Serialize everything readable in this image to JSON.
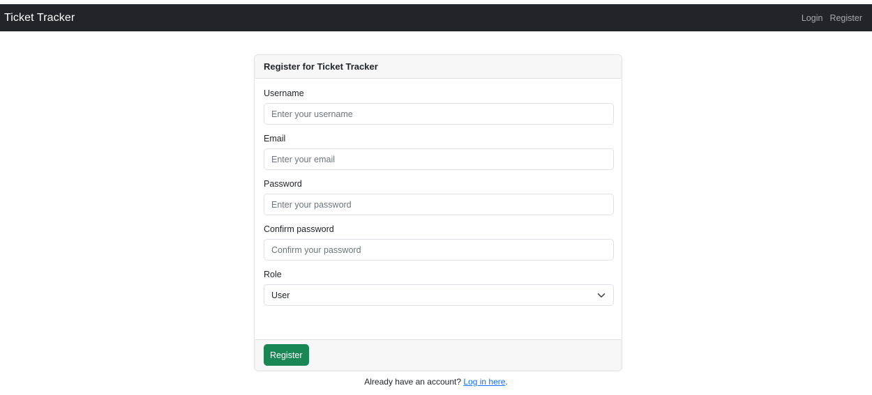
{
  "navbar": {
    "brand": "Ticket Tracker",
    "links": [
      "Login",
      "Register"
    ]
  },
  "card": {
    "title": "Register for Ticket Tracker",
    "fields": {
      "username": {
        "label": "Username",
        "placeholder": "Enter your username",
        "value": ""
      },
      "email": {
        "label": "Email",
        "placeholder": "Enter your email",
        "value": ""
      },
      "password": {
        "label": "Password",
        "placeholder": "Enter your password",
        "value": ""
      },
      "confirm": {
        "label": "Confirm password",
        "placeholder": "Confirm your password",
        "value": ""
      },
      "role": {
        "label": "Role",
        "value": "User"
      }
    },
    "submit_label": "Register"
  },
  "footer": {
    "prompt": "Already have an account?",
    "link": "Log in here",
    "suffix": "."
  },
  "colors": {
    "navbar_bg": "#212529",
    "primary_button": "#198754",
    "link": "#0d6efd"
  },
  "icons": {
    "role_select": "chevron-down-icon"
  }
}
